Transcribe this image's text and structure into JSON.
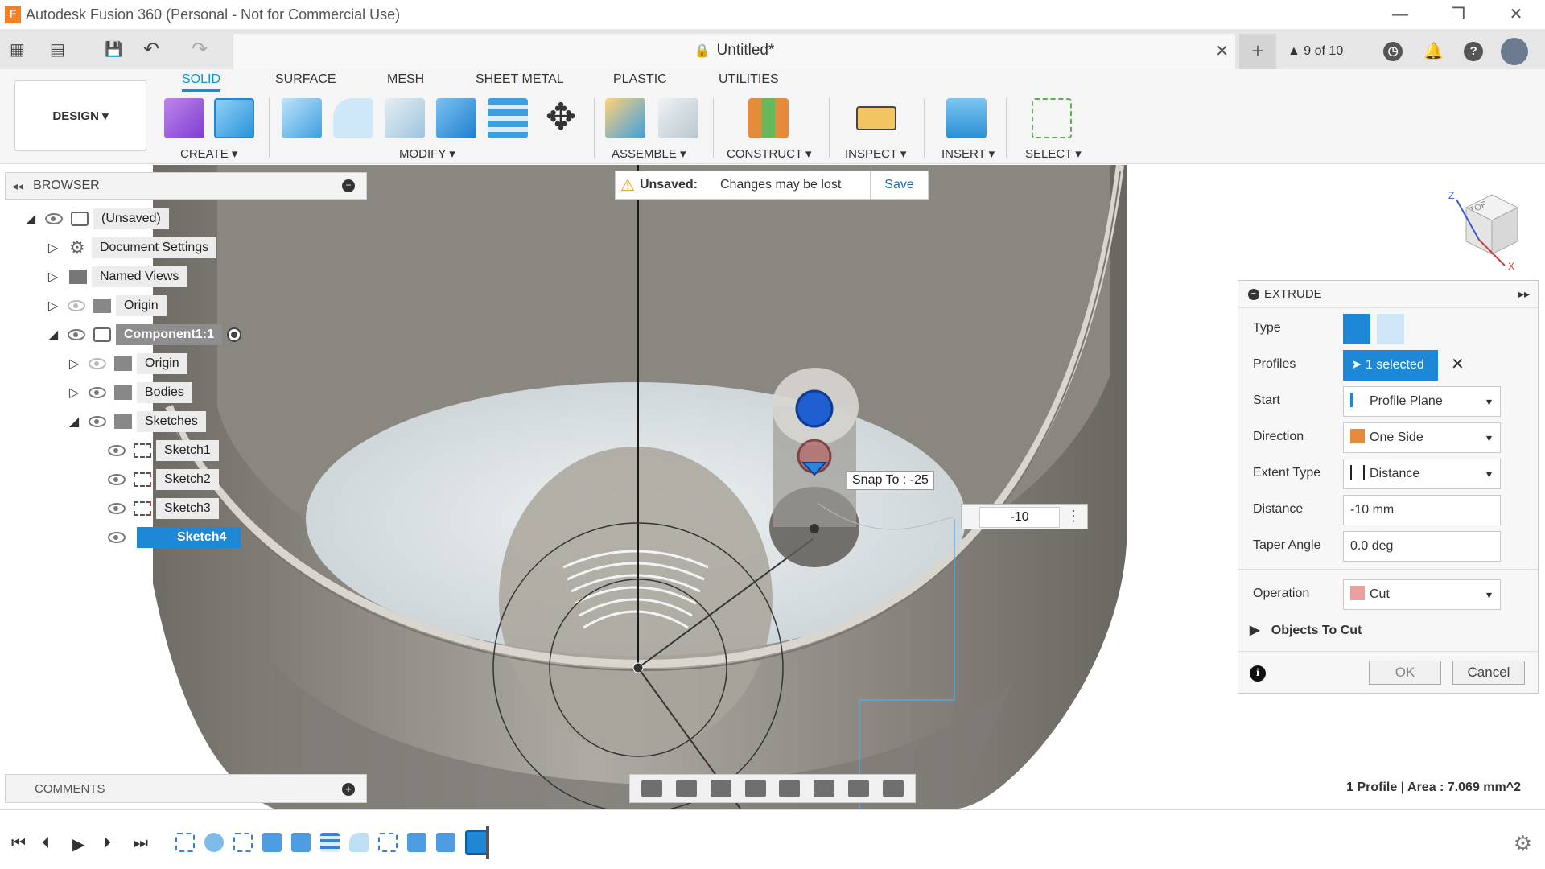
{
  "window": {
    "title": "Autodesk Fusion 360 (Personal - Not for Commercial Use)",
    "app_letter": "F",
    "minimize": "—",
    "restore": "❐",
    "close": "✕"
  },
  "qat": {
    "apps_icon": "▦",
    "file_icon": "▤",
    "save_icon": "💾",
    "undo_icon": "↶",
    "redo_icon": "↷",
    "document_title": "Untitled*",
    "tab_close": "✕",
    "new_tab": "+",
    "jobs_label": "9 of 10",
    "clock_icon": "◷",
    "bell_icon": "🔔",
    "help_icon": "?"
  },
  "ribbon": {
    "workspace": "DESIGN ▾",
    "tabs": [
      "SOLID",
      "SURFACE",
      "MESH",
      "SHEET METAL",
      "PLASTIC",
      "UTILITIES"
    ],
    "active_tab": "SOLID",
    "groups": [
      "CREATE ▾",
      "MODIFY ▾",
      "ASSEMBLE ▾",
      "CONSTRUCT ▾",
      "INSPECT ▾",
      "INSERT ▾",
      "SELECT ▾"
    ]
  },
  "notice": {
    "warn_icon": "⚠",
    "label": "Unsaved:",
    "message": "Changes may be lost",
    "save": "Save"
  },
  "browser": {
    "collapse_icon": "◂◂",
    "title": "BROWSER",
    "minus": "−",
    "items": [
      {
        "label": "(Unsaved)",
        "toggle": "◢"
      },
      {
        "label": "Document Settings",
        "toggle": "▷"
      },
      {
        "label": "Named Views",
        "toggle": "▷"
      },
      {
        "label": "Origin",
        "toggle": "▷"
      },
      {
        "label": "Component1:1",
        "toggle": "◢"
      },
      {
        "label": "Origin",
        "toggle": "▷"
      },
      {
        "label": "Bodies",
        "toggle": "▷"
      },
      {
        "label": "Sketches",
        "toggle": "◢"
      },
      {
        "label": "Sketch1",
        "toggle": ""
      },
      {
        "label": "Sketch2",
        "toggle": ""
      },
      {
        "label": "Sketch3",
        "toggle": ""
      },
      {
        "label": "Sketch4",
        "toggle": ""
      }
    ]
  },
  "viewport": {
    "snap_tooltip": "Snap To : -25",
    "distance_input": "-10",
    "more_icon": "⋮",
    "viewcube_face": "TOP",
    "axis_z": "Z",
    "axis_x": "X"
  },
  "extrude": {
    "title": "EXTRUDE",
    "expand_icon": "▸▸",
    "type_label": "Type",
    "profiles_label": "Profiles",
    "profiles_value": "1 selected",
    "clear_icon": "✕",
    "start_label": "Start",
    "start_value": "Profile Plane",
    "direction_label": "Direction",
    "direction_value": "One Side",
    "extent_label": "Extent Type",
    "extent_value": "Distance",
    "distance_label": "Distance",
    "distance_value": "-10 mm",
    "taper_label": "Taper Angle",
    "taper_value": "0.0 deg",
    "operation_label": "Operation",
    "operation_value": "Cut",
    "objects_label": "Objects To Cut",
    "objects_toggle": "▶",
    "info_icon": "i",
    "ok": "OK",
    "cancel": "Cancel"
  },
  "comments": {
    "title": "COMMENTS",
    "plus": "+"
  },
  "status": {
    "text": "1 Profile | Area : 7.069 mm^2"
  },
  "timeline": {
    "first": "⏮",
    "prev": "⏴",
    "play": "▶",
    "next": "⏵",
    "last": "⏭",
    "gear": "⚙"
  },
  "colors": {
    "accent": "#0696d7",
    "selection": "#1f88d6",
    "model_shell": "#8c8a84",
    "model_floor": "#dfe4e6"
  }
}
